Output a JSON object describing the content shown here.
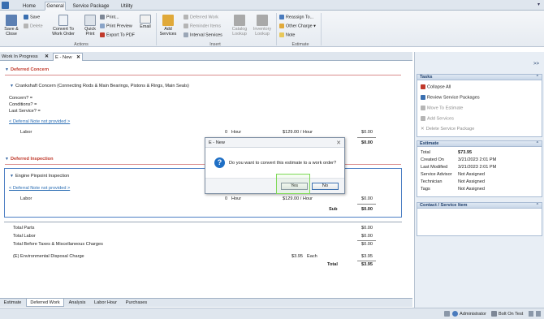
{
  "ribbon": {
    "tabs": [
      "Home",
      "General",
      "Service Package",
      "Utility"
    ],
    "active_tab": "General",
    "save_close": "Save &\nClose",
    "save": "Save",
    "delete": "Delete",
    "convert": "Convert To\nWork Order",
    "quick_print": "Quick\nPrint",
    "print": "Print...",
    "print_preview": "Print Preview",
    "export_pdf": "Export To PDF",
    "email": "Email",
    "add_services": "Add\nServices",
    "deferred_work": "Deferred Work",
    "reminder_items": "Reminder Items",
    "interval_services": "Interval Services",
    "catalog_lookup": "Catalog\nLookup",
    "inventory_lookup": "Inventory\nLookup",
    "reassign_to": "Reassign To...",
    "other_charge": "Other Charge",
    "note": "Note",
    "groups": [
      "Actions",
      "Insert",
      "Estimate"
    ],
    "colors": {
      "accent": "#3a6fb0",
      "pdf": "#c0392b",
      "dim": "#8c8c8c"
    }
  },
  "doc_tabs": [
    {
      "label": "Work In Progress",
      "close": "✕"
    },
    {
      "label": "E - New",
      "close": "✕"
    }
  ],
  "main": {
    "deferred_concern": {
      "header": "Deferred Concern",
      "item": "Crankshaft Concern (Connecting Rods & Main Bearings, Pistons & Rings, Main Seals)",
      "concern": "Concern?  =",
      "conditions": "Conditions?  =",
      "last_service": "Last Service?  =",
      "note_link": "< Deferral Note not provided >",
      "labor_label": "Labor",
      "labor_qty": "0",
      "labor_unit": "Hour",
      "labor_rate": "$129.00  / Hour",
      "labor_total": "$0.00",
      "sub_total": "$0.00"
    },
    "deferred_inspection": {
      "header": "Deferred Inspection",
      "item": "Engine Pinpoint Inspection",
      "note_link": "< Deferral Note not provided >",
      "labor_label": "Labor",
      "labor_qty": "0",
      "labor_unit": "Hour",
      "labor_rate": "$129.00  / Hour",
      "labor_total": "$0.00",
      "sub_label": "Sub",
      "sub_total": "$0.00"
    },
    "totals": {
      "parts_label": "Total Parts",
      "parts": "$0.00",
      "labor_label": "Total Labor",
      "labor": "$0.00",
      "before_tax_label": "Total Before Taxes & Miscellaneous Charges",
      "before_tax": "$0.00",
      "env_label": "(E) Environmental Disposal Charge",
      "env_rate": "$3.95",
      "env_unit": "Each",
      "env_total": "$3.95",
      "total_label": "Total",
      "total": "$3.95"
    }
  },
  "bottom_tabs": [
    "Estimate",
    "Deferred Work",
    "Analysis",
    "Labor Hour",
    "Purchases"
  ],
  "active_bottom_tab": "Deferred Work",
  "side": {
    "expand": ">>",
    "tasks_header": "Tasks",
    "tasks": [
      {
        "label": "Collapse All",
        "enabled": true
      },
      {
        "label": "Review Service Packages",
        "enabled": true
      },
      {
        "label": "Move To Estimate",
        "enabled": false
      },
      {
        "label": "Add Services",
        "enabled": false
      },
      {
        "label": "Delete Service Package",
        "enabled": false
      }
    ],
    "estimate_header": "Estimate",
    "estimate": [
      {
        "k": "Total",
        "v": "$73.95"
      },
      {
        "k": "Created On",
        "v": "3/21/2023 2:01 PM"
      },
      {
        "k": "Last Modified",
        "v": "3/21/2023 2:01 PM"
      },
      {
        "k": "Service Advisor",
        "v": "Not Assigned"
      },
      {
        "k": "Technician",
        "v": "Not Assigned"
      },
      {
        "k": "Tags",
        "v": "Not Assigned"
      }
    ],
    "contact_header": "Contact / Service Item"
  },
  "dialog": {
    "title": "E - New",
    "close": "✕",
    "icon": "?",
    "message": "Do you want to convert this estimate to a work order?",
    "yes": "Yes",
    "no": "No"
  },
  "status": {
    "user": "Administrator",
    "company": "Bolt On Test"
  }
}
